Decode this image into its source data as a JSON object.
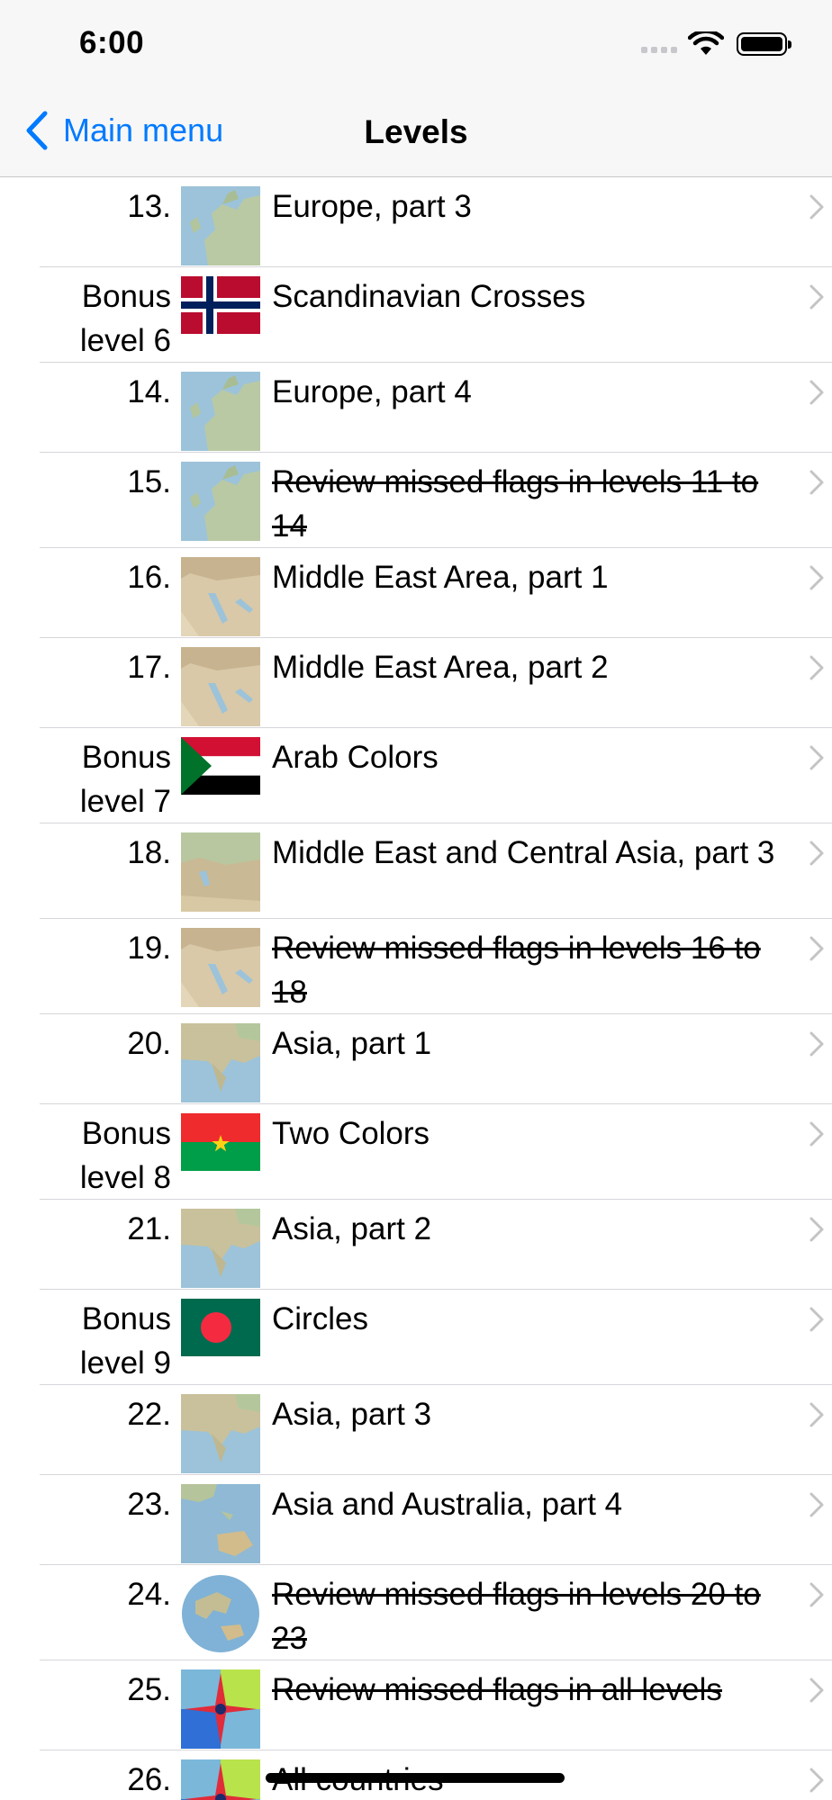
{
  "status_bar": {
    "time": "6:00"
  },
  "nav": {
    "back_label": "Main menu",
    "title": "Levels"
  },
  "levels": [
    {
      "number": "13.",
      "title": "Europe, part 3",
      "thumb": "map-europe",
      "struck": false,
      "h": 100
    },
    {
      "number": "Bonus level 6",
      "title": "Scandinavian Crosses",
      "thumb": "flag-norway",
      "struck": false,
      "h": 106
    },
    {
      "number": "14.",
      "title": "Europe, part 4",
      "thumb": "map-europe",
      "struck": false,
      "h": 100
    },
    {
      "number": "15.",
      "title": "Review missed flags in levels 11 to 14",
      "thumb": "map-europe",
      "struck": true,
      "h": 106
    },
    {
      "number": "16.",
      "title": "Middle East Area, part 1",
      "thumb": "map-middle-east",
      "struck": false,
      "h": 100
    },
    {
      "number": "17.",
      "title": "Middle East Area, part 2",
      "thumb": "map-middle-east",
      "struck": false,
      "h": 100
    },
    {
      "number": "Bonus level 7",
      "title": "Arab Colors",
      "thumb": "flag-sudan",
      "struck": false,
      "h": 106
    },
    {
      "number": "18.",
      "title": "Middle East and Central Asia, part 3",
      "thumb": "map-central-asia",
      "struck": false,
      "h": 106
    },
    {
      "number": "19.",
      "title": "Review missed flags in levels 16 to 18",
      "thumb": "map-middle-east",
      "struck": true,
      "h": 106
    },
    {
      "number": "20.",
      "title": "Asia, part 1",
      "thumb": "map-asia",
      "struck": false,
      "h": 100
    },
    {
      "number": "Bonus level 8",
      "title": "Two Colors",
      "thumb": "flag-burkina-faso",
      "struck": false,
      "h": 106
    },
    {
      "number": "21.",
      "title": "Asia, part 2",
      "thumb": "map-asia",
      "struck": false,
      "h": 100
    },
    {
      "number": "Bonus level 9",
      "title": "Circles",
      "thumb": "flag-bangladesh",
      "struck": false,
      "h": 106
    },
    {
      "number": "22.",
      "title": "Asia, part 3",
      "thumb": "map-asia",
      "struck": false,
      "h": 100
    },
    {
      "number": "23.",
      "title": "Asia and Australia, part 4",
      "thumb": "map-australia",
      "struck": false,
      "h": 100
    },
    {
      "number": "24.",
      "title": "Review missed flags in levels 20 to 23",
      "thumb": "globe",
      "struck": true,
      "h": 106
    },
    {
      "number": "25.",
      "title": "Review missed flags in all levels",
      "thumb": "compass-map",
      "struck": true,
      "h": 100
    },
    {
      "number": "26.",
      "title": "All countries",
      "thumb": "compass-map",
      "struck": true,
      "h": 100
    }
  ]
}
